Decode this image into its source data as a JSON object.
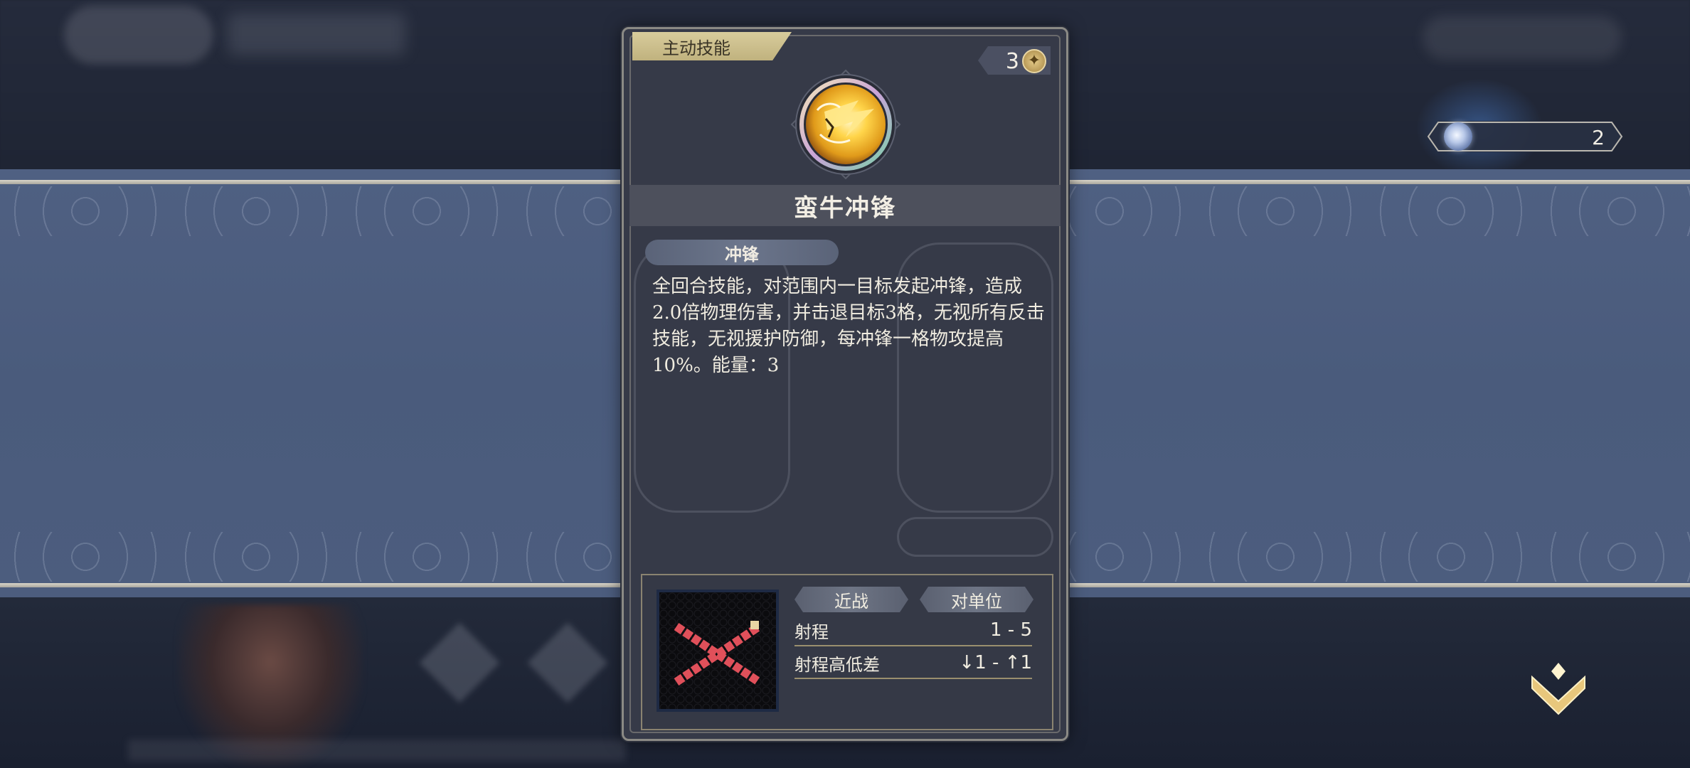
{
  "card": {
    "type_label": "主动技能",
    "cost": "3",
    "skill_name": "蛮牛冲锋",
    "tag": "冲锋",
    "description": "全回合技能，对范围内一目标发起冲锋，造成2.0倍物理伤害，并击退目标3格，无视所有反击技能，无视援护防御，每冲锋一格物攻提高10%。能量：3",
    "attack_type": "近战",
    "target_type": "对单位",
    "stats": [
      {
        "label": "射程",
        "value": "1 - 5"
      },
      {
        "label": "射程高低差",
        "value": "↓1 - ↑1"
      }
    ]
  },
  "counter": {
    "value": "2"
  },
  "icons": {
    "cost_icon": "star-coin-icon",
    "skill_icon": "charging-bull-lightning-icon",
    "counter_icon": "orb-icon",
    "collapse_icon": "chevron-down-icon"
  },
  "colors": {
    "card_bg": "#363a48",
    "tab_gold": "#c8bb88",
    "band_blue": "#4f6082",
    "accent_red": "#e0505a"
  }
}
